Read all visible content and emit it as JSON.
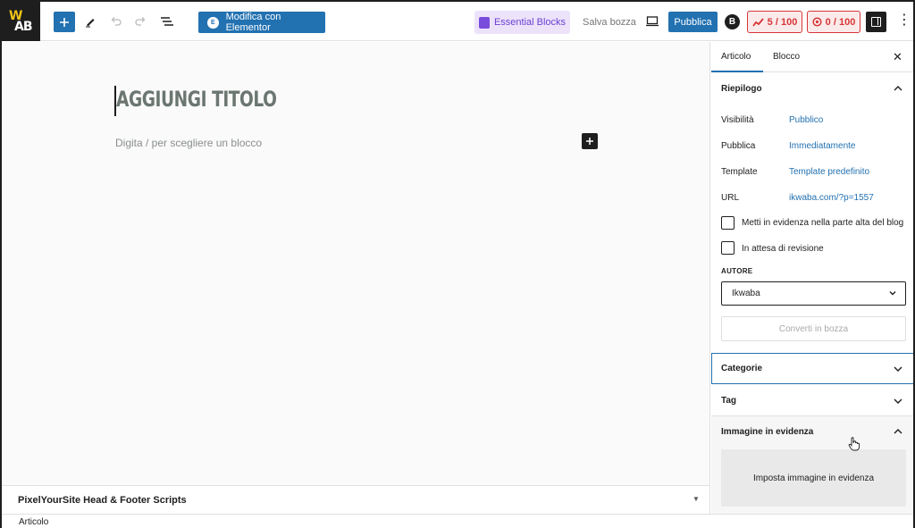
{
  "toolbar": {
    "logo_top": "W",
    "logo_bottom": "AB",
    "elementor_label": "Modifica con Elementor",
    "elementor_icon": "elementor-icon",
    "essential_blocks_label": "Essential Blocks",
    "save_draft_label": "Salva bozza",
    "publish_label": "Pubblica",
    "b_badge": "B",
    "seo_score": "5 / 100",
    "readability_score": "0 / 100",
    "accent_color": "#2271b1",
    "score_color": "#d63638"
  },
  "editor": {
    "title_placeholder": "AGGIUNGI TITOLO",
    "block_hint": "Digita / per scegliere un blocco"
  },
  "metabox": {
    "title": "PixelYourSite Head & Footer Scripts"
  },
  "statusbar": {
    "breadcrumb": "Articolo"
  },
  "sidebar": {
    "tabs": [
      "Articolo",
      "Blocco"
    ],
    "summary": {
      "title": "Riepilogo",
      "rows": [
        {
          "label": "Visibilità",
          "value": "Pubblico"
        },
        {
          "label": "Pubblica",
          "value": "Immediatamente"
        },
        {
          "label": "Template",
          "value": "Template predefinito"
        },
        {
          "label": "URL",
          "value": "ikwaba.com/?p=1557"
        }
      ],
      "checkboxes": [
        "Metti in evidenza nella parte alta del blog",
        "In attesa di revisione"
      ],
      "author_label": "AUTORE",
      "author_value": "Ikwaba",
      "convert_label": "Converti in bozza"
    },
    "categories_title": "Categorie",
    "tags_title": "Tag",
    "featured_title": "Immagine in evidenza",
    "featured_button": "Imposta immagine in evidenza"
  }
}
